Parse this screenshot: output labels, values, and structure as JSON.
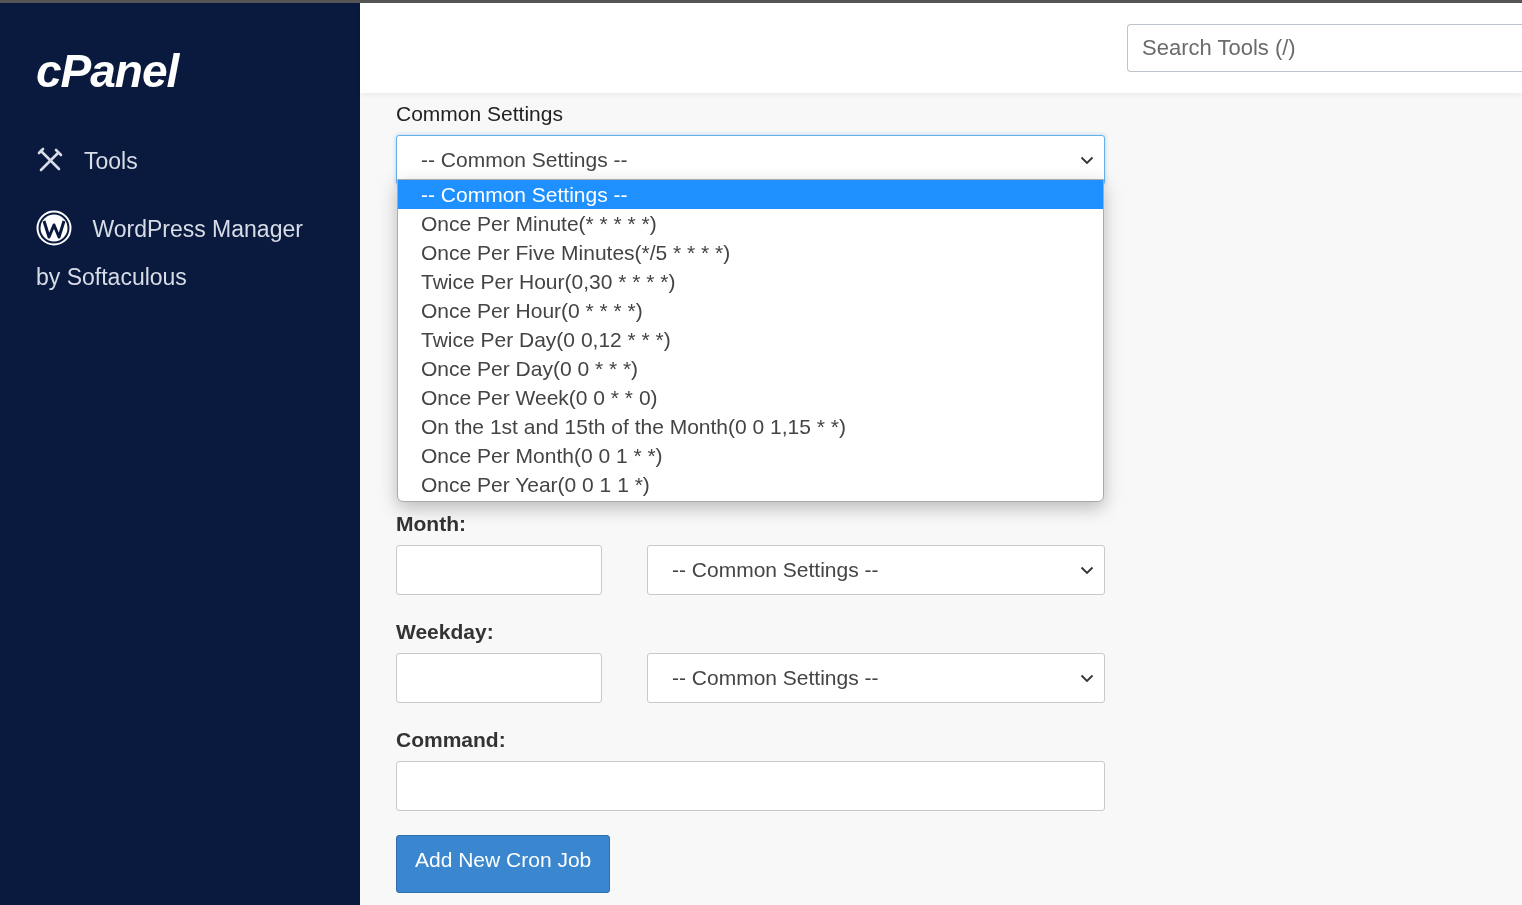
{
  "sidebar": {
    "logo": "cPanel",
    "items": [
      {
        "label": "Tools",
        "kind": "tools"
      },
      {
        "label": "WordPress Manager by Softaculous",
        "kind": "wordpress"
      }
    ]
  },
  "search": {
    "placeholder": "Search Tools (/)"
  },
  "common_settings": {
    "label": "Common Settings",
    "value": "-- Common Settings --",
    "expanded": true,
    "options": [
      {
        "label": "-- Common Settings --",
        "selected": true
      },
      {
        "label": "Once Per Minute(* * * * *)",
        "selected": false
      },
      {
        "label": "Once Per Five Minutes(*/5 * * * *)",
        "selected": false
      },
      {
        "label": "Twice Per Hour(0,30 * * * *)",
        "selected": false
      },
      {
        "label": "Once Per Hour(0 * * * *)",
        "selected": false
      },
      {
        "label": "Twice Per Day(0 0,12 * * *)",
        "selected": false
      },
      {
        "label": "Once Per Day(0 0 * * *)",
        "selected": false
      },
      {
        "label": "Once Per Week(0 0 * * 0)",
        "selected": false
      },
      {
        "label": "On the 1st and 15th of the Month(0 0 1,15 * *)",
        "selected": false
      },
      {
        "label": "Once Per Month(0 0 1 * *)",
        "selected": false
      },
      {
        "label": "Once Per Year(0 0 1 1 *)",
        "selected": false
      }
    ]
  },
  "fields": [
    {
      "label": "Month:",
      "select_value": "-- Common Settings --"
    },
    {
      "label": "Weekday:",
      "select_value": "-- Common Settings --"
    }
  ],
  "command": {
    "label": "Command:"
  },
  "submit_button": "Add New Cron Job"
}
